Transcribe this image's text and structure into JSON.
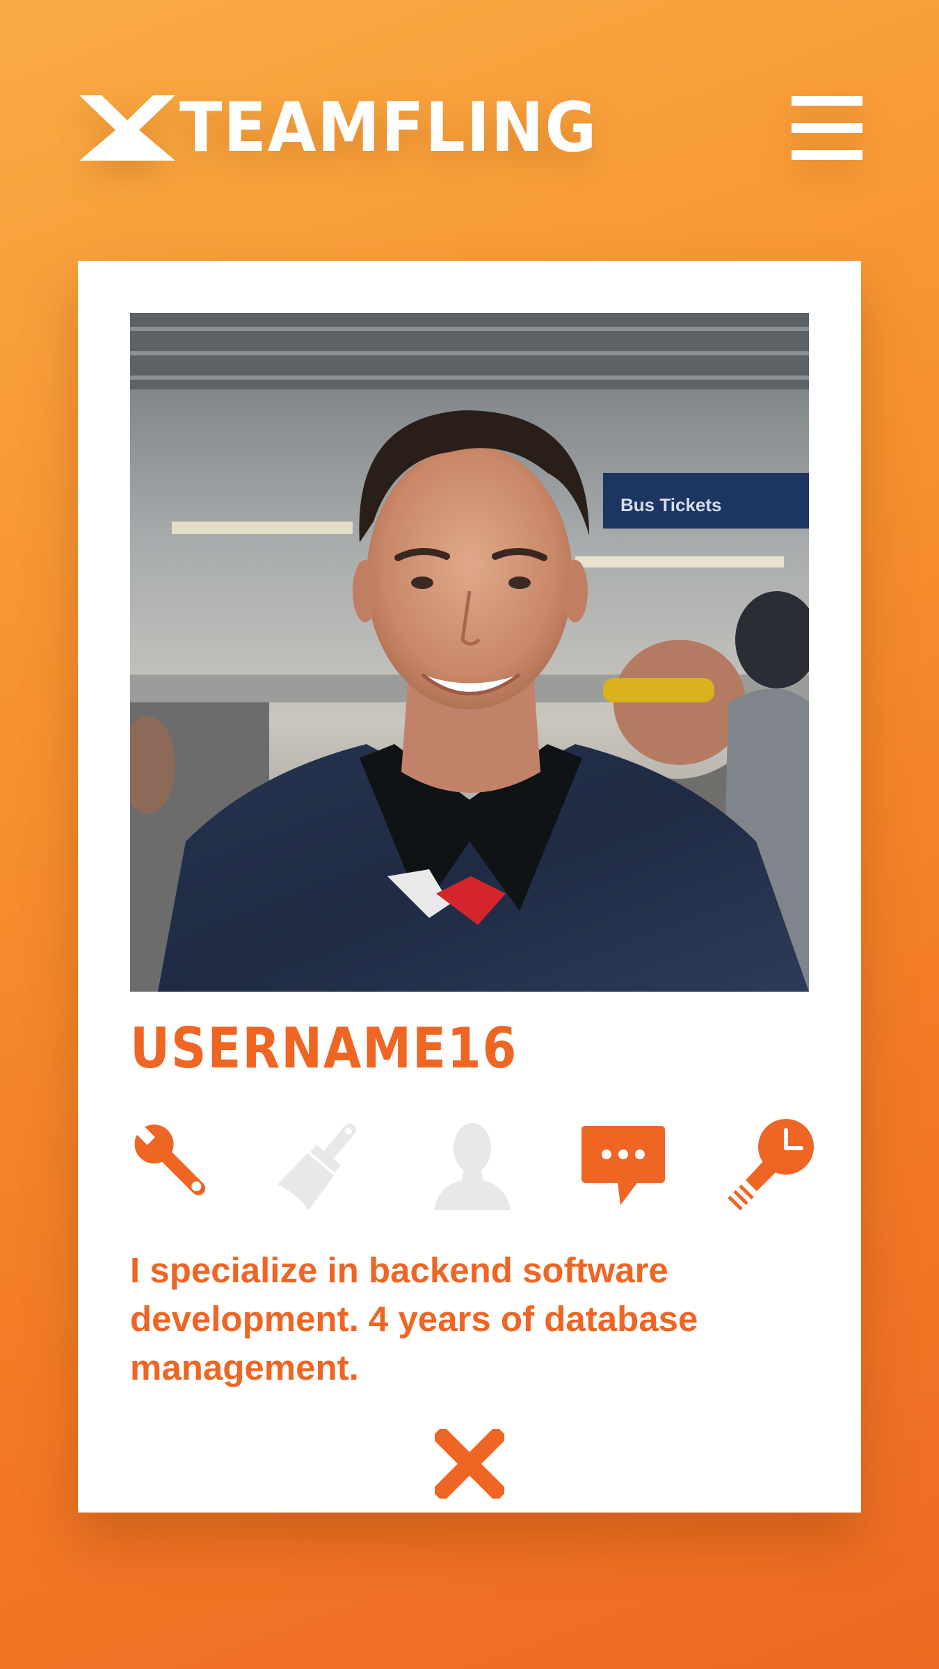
{
  "app": {
    "logo_text": "TEAMFLING",
    "menu_icon": "hamburger-menu-icon"
  },
  "profile": {
    "photo_alt": "Profile photo",
    "username": "USERNAME16",
    "bio": "I specialize in backend software development. 4 years of database management.",
    "skills": [
      {
        "icon": "wrench-icon",
        "active": true
      },
      {
        "icon": "paintbrush-icon",
        "active": false
      },
      {
        "icon": "person-icon",
        "active": false
      },
      {
        "icon": "speech-bubble-icon",
        "active": true
      },
      {
        "icon": "lightbulb-clock-icon",
        "active": true
      }
    ]
  },
  "actions": {
    "close_icon": "close-icon"
  },
  "colors": {
    "accent": "#ef6524",
    "inactive": "#e8e8e8",
    "background_top": "#f9ab44",
    "background_bottom": "#ee6a22",
    "card": "#ffffff"
  }
}
